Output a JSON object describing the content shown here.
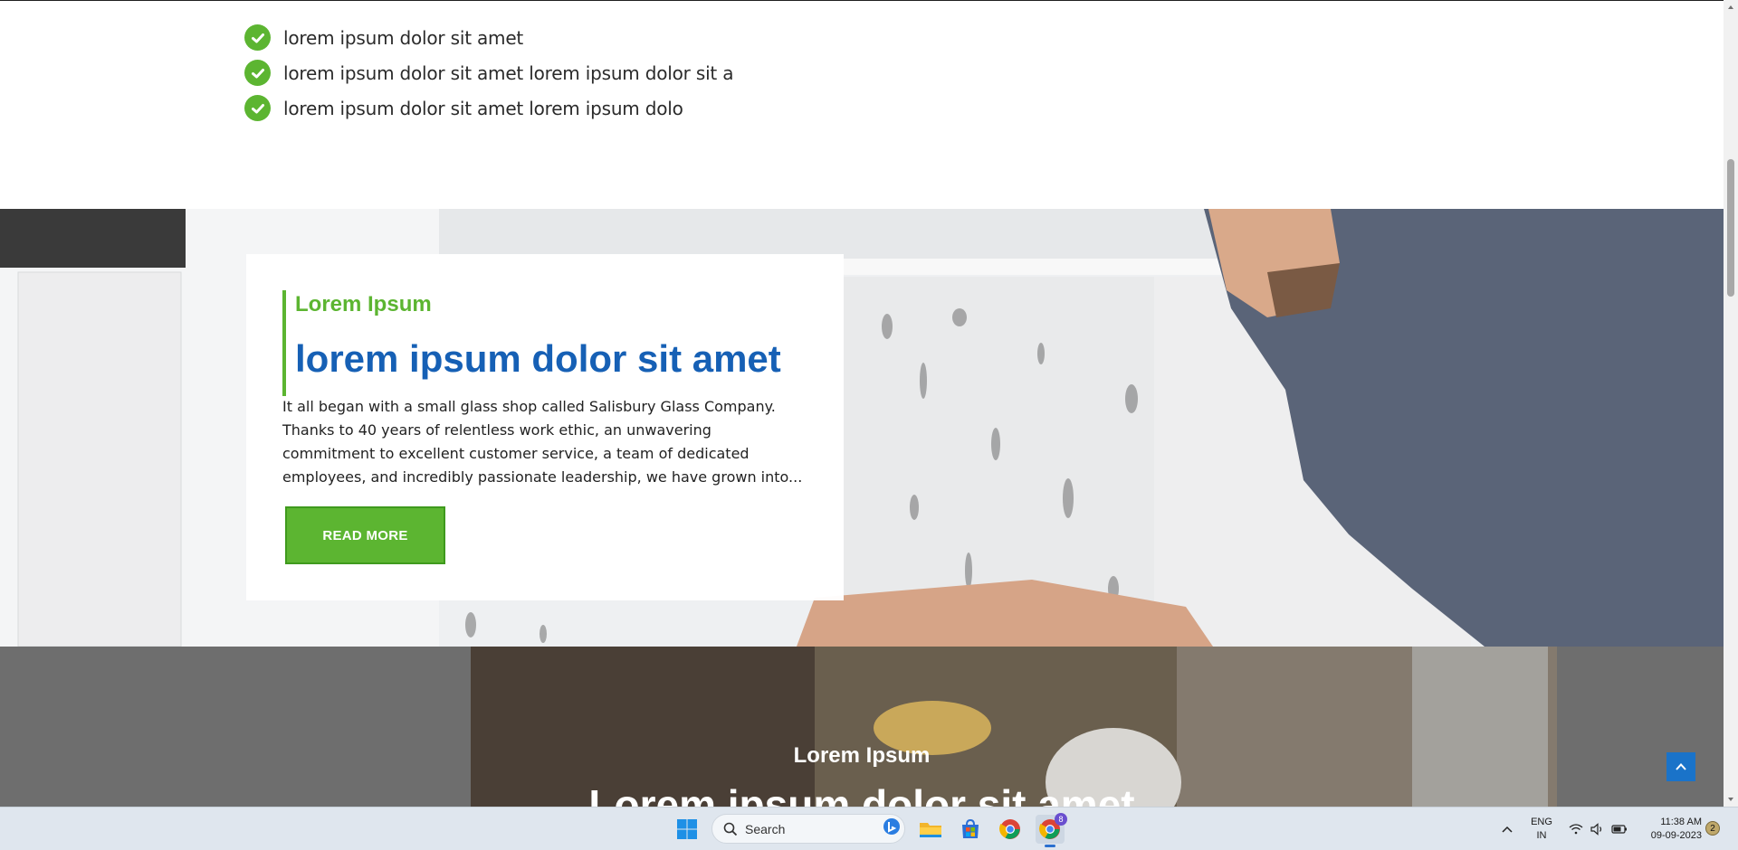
{
  "checklist": [
    "lorem ipsum dolor sit amet",
    "lorem ipsum dolor sit amet lorem ipsum dolor sit a",
    "lorem ipsum dolor sit amet lorem ipsum dolo"
  ],
  "feature": {
    "eyebrow": "Lorem Ipsum",
    "title": "lorem ipsum dolor sit amet",
    "body": "It all began with a small glass shop called Salisbury Glass Company. Thanks to 40 years of relentless work ethic, an unwavering commitment to excellent customer service, a team of dedicated employees, and incredibly passionate leadership, we have grown into...",
    "button_label": "READ MORE"
  },
  "next_section": {
    "eyebrow": "Lorem Ipsum",
    "title": "Lorem ipsum dolor sit amet"
  },
  "taskbar": {
    "search_label": "Search",
    "lang_line1": "ENG",
    "lang_line2": "IN",
    "time": "11:38 AM",
    "date": "09-09-2023",
    "notification_count": "2",
    "chrome_badge": "8",
    "icons": [
      "windows-start-icon",
      "search-icon",
      "bing-icon",
      "file-explorer-icon",
      "microsoft-store-icon",
      "chrome-icon",
      "chrome-profile-icon",
      "chevron-up-icon",
      "wifi-icon",
      "speaker-icon",
      "battery-icon"
    ]
  },
  "colors": {
    "accent_green": "#5cb531",
    "title_blue": "#1660b5",
    "scroll_top_blue": "#1a73c9"
  }
}
